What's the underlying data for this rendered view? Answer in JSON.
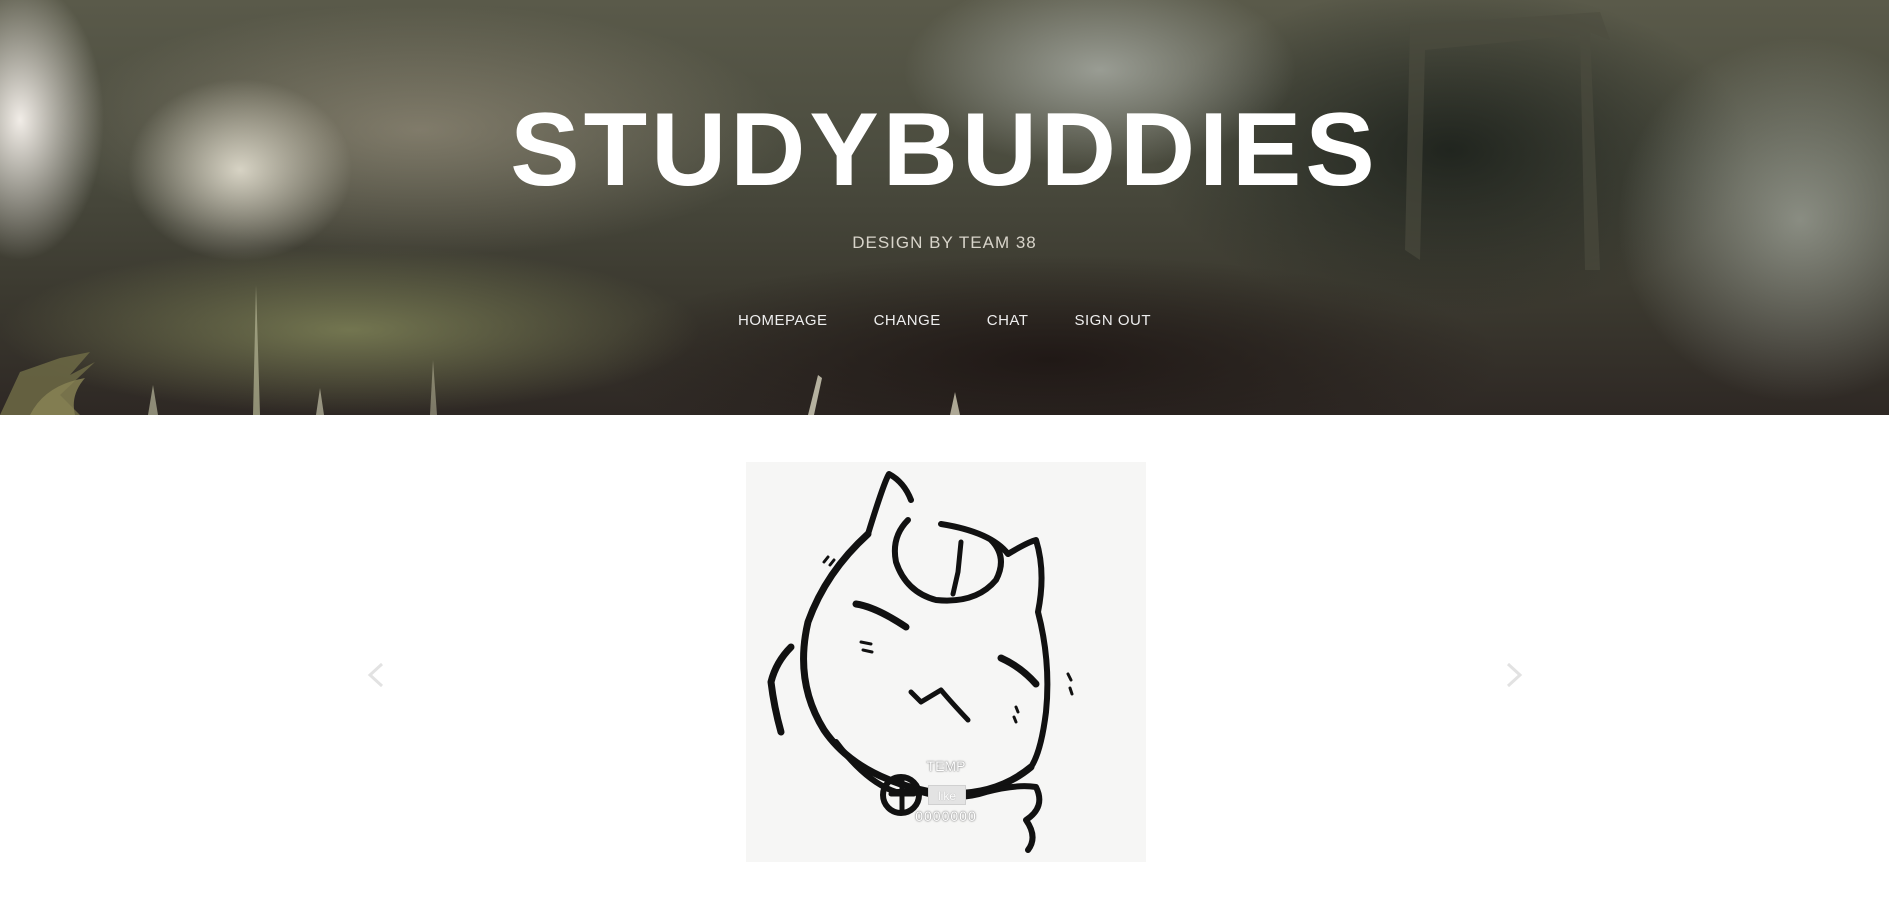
{
  "header": {
    "title": "STUDYBUDDIES",
    "subtitle": "DESIGN BY TEAM 38"
  },
  "nav": {
    "items": [
      {
        "label": "HOMEPAGE"
      },
      {
        "label": "CHANGE"
      },
      {
        "label": "CHAT"
      },
      {
        "label": "SIGN OUT"
      }
    ]
  },
  "carousel": {
    "caption_title": "TEMP",
    "like_label": "like",
    "like_count": "0000000",
    "prev_icon": "chevron-left-icon",
    "next_icon": "chevron-right-icon"
  },
  "colors": {
    "title": "#ffffff",
    "nav_text": "#eeeeee",
    "page_background": "#ffffff"
  }
}
